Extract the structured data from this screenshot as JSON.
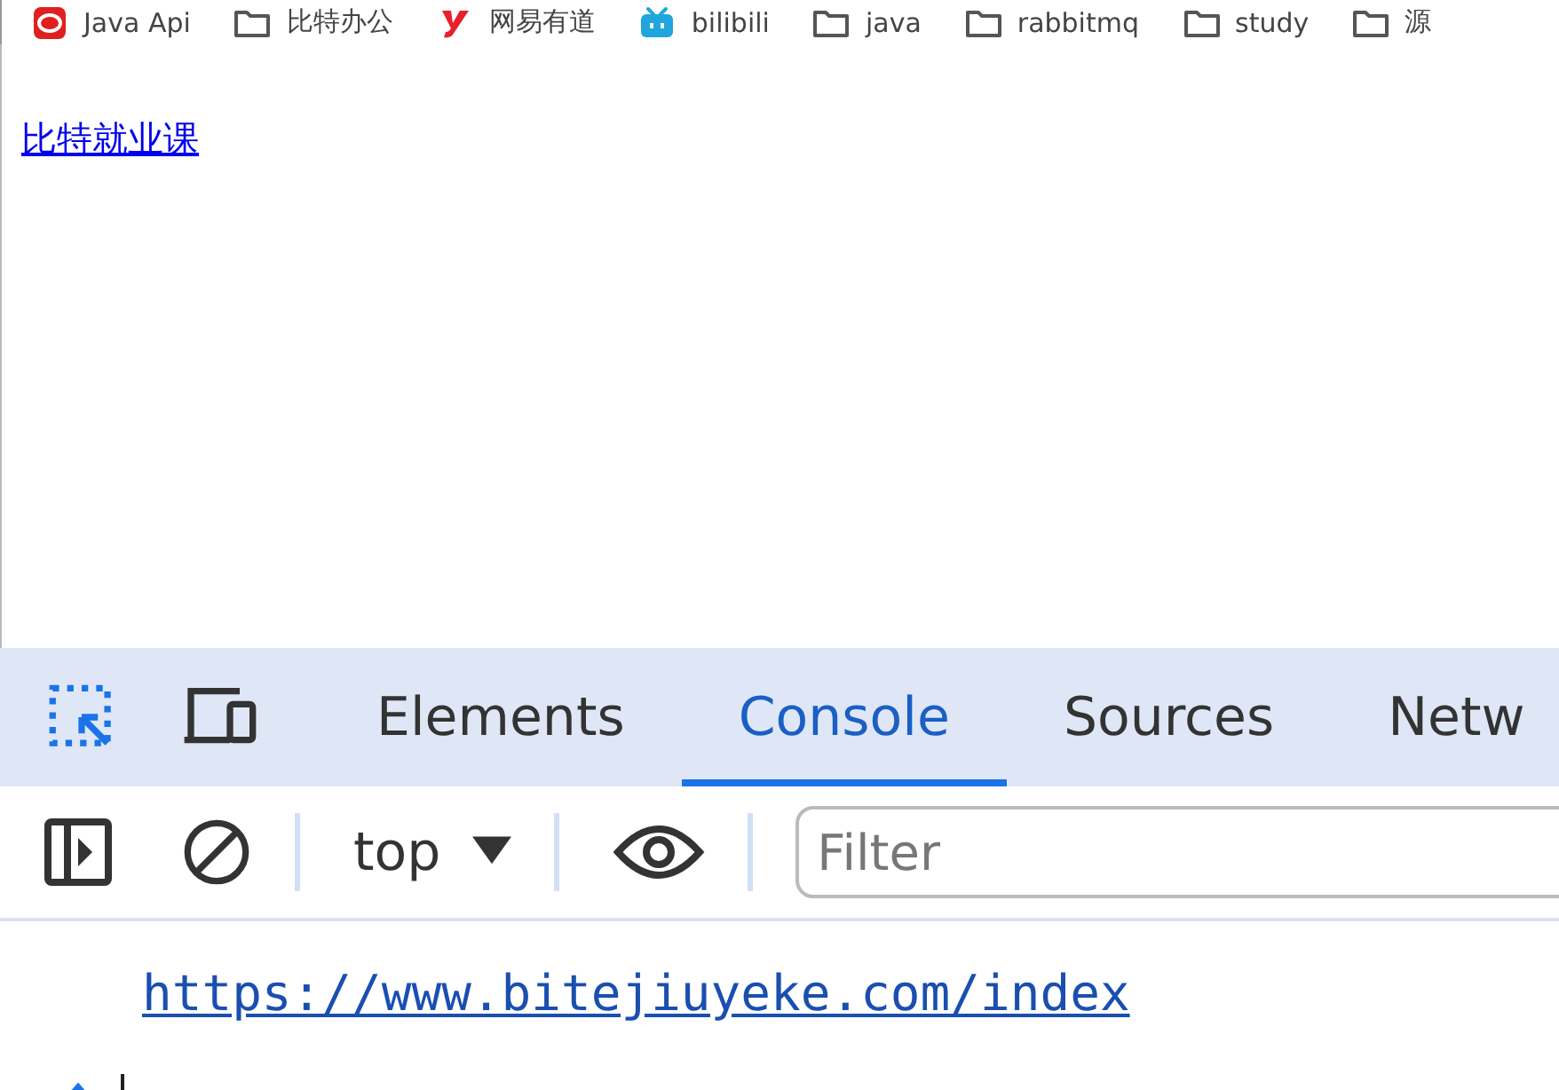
{
  "bookmarks": [
    {
      "kind": "opera",
      "label": "Java Api"
    },
    {
      "kind": "folder",
      "label": "比特办公"
    },
    {
      "kind": "youdao",
      "label": "网易有道"
    },
    {
      "kind": "tv",
      "label": "bilibili"
    },
    {
      "kind": "folder",
      "label": "java"
    },
    {
      "kind": "folder",
      "label": "rabbitmq"
    },
    {
      "kind": "folder",
      "label": "study"
    },
    {
      "kind": "folder",
      "label": "源"
    }
  ],
  "page": {
    "link": "比特就业课"
  },
  "devtools": {
    "tabs": [
      {
        "label": "Elements",
        "selected": false
      },
      {
        "label": "Console",
        "selected": true
      },
      {
        "label": "Sources",
        "selected": false
      },
      {
        "label": "Netw",
        "selected": false
      }
    ],
    "context": "top",
    "filter": {
      "placeholder": "Filter"
    },
    "console": [
      {
        "kind": "link",
        "text": "https://www.bitejiuyeke.com/index"
      }
    ]
  }
}
